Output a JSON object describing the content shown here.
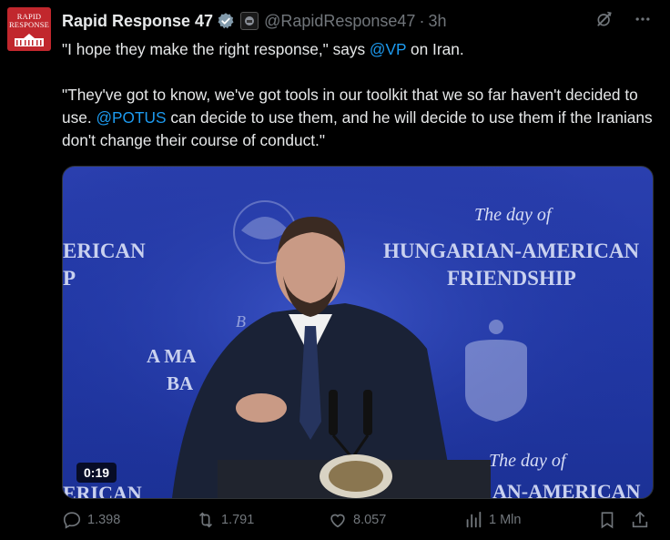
{
  "post": {
    "author_name": "Rapid Response 47",
    "handle": "@RapidResponse47",
    "separator": "·",
    "time": "3h",
    "avatar_text_line1": "RAPID",
    "avatar_text_line2": "RESPONSE",
    "text_p1_a": "\"I hope they make the right response,\" says ",
    "text_p1_mention": "@VP",
    "text_p1_b": " on Iran.",
    "text_p2_a": "\"They've got to know, we've got tools in our toolkit that we so far haven't decided to use. ",
    "text_p2_mention": "@POTUS",
    "text_p2_b": " can decide to use them, and he will decide to use them if the Iranians don't change their course of conduct.\""
  },
  "media": {
    "video_time": "0:19",
    "backdrop": {
      "script_top": "The day of",
      "line1": "HUNGARIAN-AMERICAN",
      "line2": "FRIENDSHIP",
      "left_line1": "ERICAN",
      "left_line2": "P",
      "left_line3": "A MA",
      "left_line4": "BA",
      "left_script": "B",
      "script_bottom": "The day of",
      "bottom_right": "AN-AMERICAN",
      "bottom_left": "ERICAN"
    }
  },
  "actions": {
    "replies": "1.398",
    "reposts": "1.791",
    "likes": "8.057",
    "views": "1 Mln"
  },
  "icons": [
    "verified-badge-icon",
    "government-badge-icon",
    "grok-icon",
    "more-icon",
    "reply-icon",
    "repost-icon",
    "like-icon",
    "views-icon",
    "bookmark-icon",
    "share-icon"
  ],
  "colors": {
    "accent": "#1d9bf0",
    "muted": "#71767b",
    "text": "#e7e9ea",
    "avatar_red": "#c1272d"
  }
}
